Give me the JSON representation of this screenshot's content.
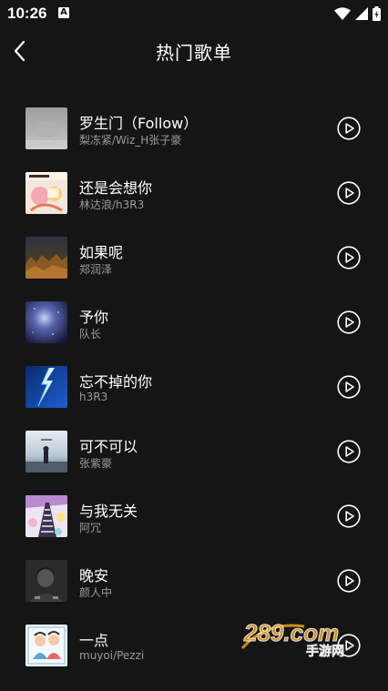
{
  "status_bar": {
    "time": "10:26",
    "notification_icon": "a-letter-icon",
    "icons": [
      "wifi-icon",
      "signal-icon",
      "battery-icon"
    ]
  },
  "header": {
    "title": "热门歌单",
    "back_icon": "chevron-left-icon"
  },
  "songs": [
    {
      "title": "罗生门（Follow）",
      "artist": "梨冻紧/Wiz_H张子豪"
    },
    {
      "title": "还是会想你",
      "artist": "林达浪/h3R3"
    },
    {
      "title": "如果呢",
      "artist": "郑润泽"
    },
    {
      "title": "予你",
      "artist": "队长"
    },
    {
      "title": "忘不掉的你",
      "artist": "h3R3"
    },
    {
      "title": "可不可以",
      "artist": "张紫豪"
    },
    {
      "title": "与我无关",
      "artist": "阿冗"
    },
    {
      "title": "晚安",
      "artist": "颜人中"
    },
    {
      "title": "一点",
      "artist": "muyoi/Pezzi"
    }
  ],
  "watermark": {
    "text": "289.com",
    "subtext": "手游网"
  },
  "colors": {
    "background": "#151515",
    "text_primary": "#ffffff",
    "text_secondary": "#9a9a9a"
  }
}
